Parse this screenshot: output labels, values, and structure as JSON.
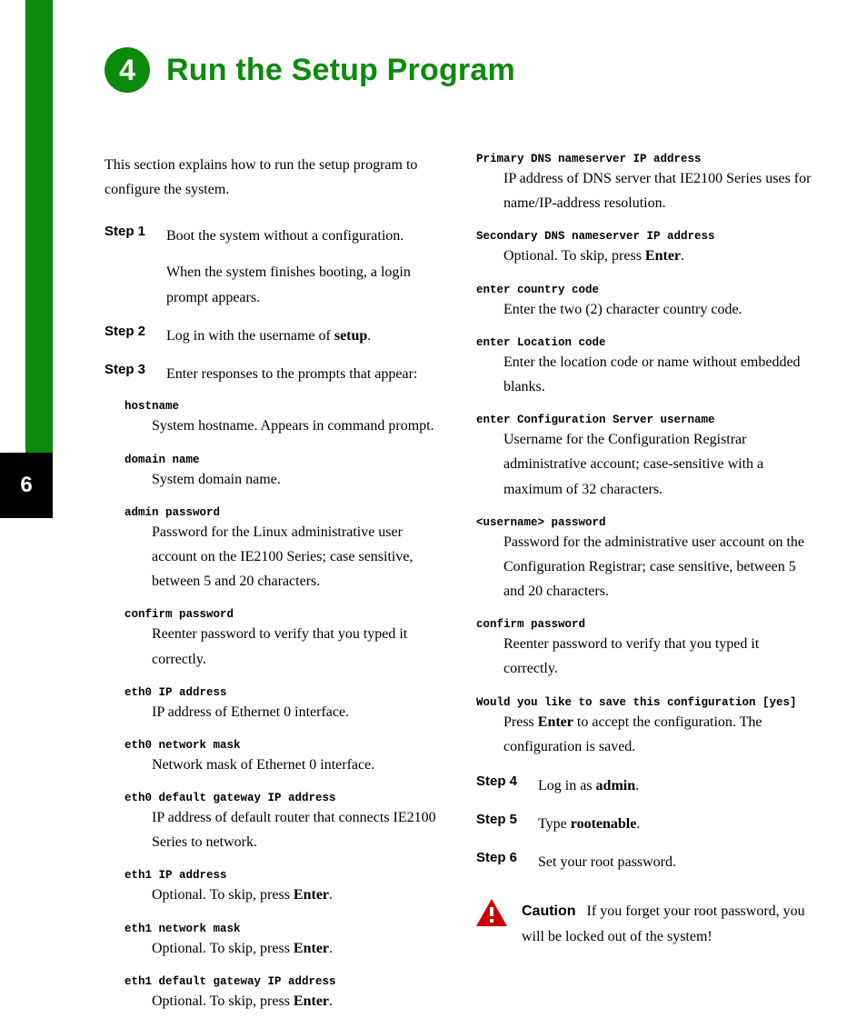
{
  "sectionNumber": "4",
  "pageTab": "6",
  "title": "Run the Setup Program",
  "intro": "This section explains how to run the setup program to configure the system.",
  "steps_col1": [
    {
      "label": "Step 1",
      "paras": [
        "Boot the system without a configuration.",
        "When the system finishes booting, a login prompt appears."
      ]
    },
    {
      "label": "Step 2",
      "paras_rich": [
        {
          "pre": "Log in with the username of ",
          "bold": "setup",
          "post": "."
        }
      ]
    },
    {
      "label": "Step 3",
      "paras": [
        "Enter responses to the prompts that appear:"
      ]
    }
  ],
  "prompts_col1": [
    {
      "label": "hostname",
      "desc": "System hostname. Appears in command prompt."
    },
    {
      "label": "domain name",
      "desc": "System domain name."
    },
    {
      "label": "admin password",
      "desc": "Password for the Linux administrative user account on the IE2100 Series; case sensitive, between 5 and 20 characters."
    },
    {
      "label": "confirm password",
      "desc": "Reenter password to verify that you typed it correctly."
    },
    {
      "label": "eth0 IP address",
      "desc": "IP address of Ethernet 0 interface."
    },
    {
      "label": "eth0 network mask",
      "desc": "Network mask of Ethernet 0 interface."
    },
    {
      "label": "eth0 default gateway IP address",
      "desc": "IP address of default router that connects IE2100 Series to network."
    },
    {
      "label": "eth1 IP address",
      "desc_rich": {
        "pre": "Optional. To skip, press ",
        "bold": "Enter",
        "post": "."
      }
    },
    {
      "label": "eth1 network mask",
      "desc_rich": {
        "pre": "Optional. To skip, press ",
        "bold": "Enter",
        "post": "."
      }
    },
    {
      "label": "eth1 default gateway IP address",
      "desc_rich": {
        "pre": "Optional. To skip, press ",
        "bold": "Enter",
        "post": "."
      }
    }
  ],
  "prompts_col2": [
    {
      "label": "Primary DNS nameserver IP address",
      "desc": "IP address of DNS server that IE2100 Series uses for name/IP-address resolution."
    },
    {
      "label": "Secondary DNS nameserver IP address",
      "desc_rich": {
        "pre": "Optional. To skip, press ",
        "bold": "Enter",
        "post": "."
      }
    },
    {
      "label": "enter country code",
      "desc": "Enter the two (2) character country code."
    },
    {
      "label": "enter Location code",
      "desc": "Enter the location code or name without embedded blanks."
    },
    {
      "label": "enter Configuration Server username",
      "desc": "Username for the Configuration Registrar administrative account; case-sensitive with a maximum of 32 characters."
    },
    {
      "label": "<username> password",
      "desc": "Password for the administrative user account on the Configuration Registrar; case sensitive, between 5 and 20 characters."
    },
    {
      "label": "confirm password",
      "desc": "Reenter password to verify that you typed it correctly."
    },
    {
      "label": "Would you like to save this configuration [yes]",
      "desc_rich": {
        "pre": "Press ",
        "bold": "Enter",
        "post": " to accept the configuration. The configuration is saved."
      }
    }
  ],
  "steps_col2": [
    {
      "label": "Step 4",
      "paras_rich": [
        {
          "pre": "Log in as ",
          "bold": "admin",
          "post": "."
        }
      ]
    },
    {
      "label": "Step 5",
      "paras_rich": [
        {
          "pre": "Type ",
          "bold": "rootenable",
          "post": "."
        }
      ]
    },
    {
      "label": "Step 6",
      "paras": [
        "Set your root password."
      ]
    }
  ],
  "caution": {
    "label": "Caution",
    "text": "If you forget your root password, you will be locked out of the system!"
  }
}
